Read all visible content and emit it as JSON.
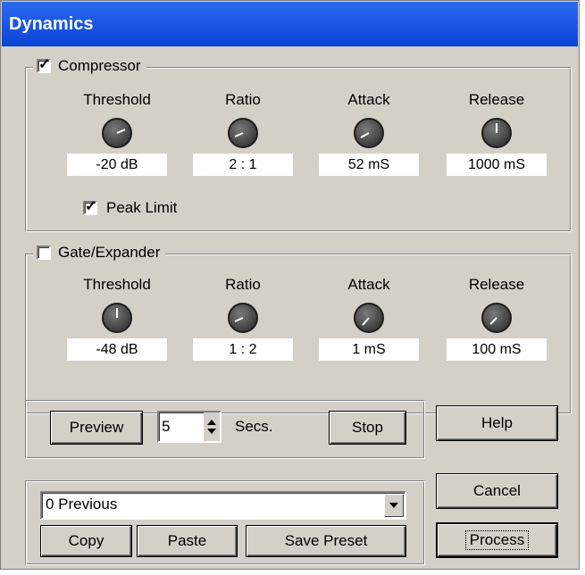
{
  "window": {
    "title": "Dynamics"
  },
  "compressor": {
    "label": "Compressor",
    "enabled": true,
    "knobs": [
      {
        "label": "Threshold",
        "value": "-20 dB"
      },
      {
        "label": "Ratio",
        "value": "2 : 1"
      },
      {
        "label": "Attack",
        "value": "52 mS"
      },
      {
        "label": "Release",
        "value": "1000 mS"
      }
    ],
    "peak_limit": {
      "label": "Peak Limit",
      "checked": true
    }
  },
  "gate": {
    "label": "Gate/Expander",
    "enabled": false,
    "knobs": [
      {
        "label": "Threshold",
        "value": "-48 dB"
      },
      {
        "label": "Ratio",
        "value": "1 : 2"
      },
      {
        "label": "Attack",
        "value": "1 mS"
      },
      {
        "label": "Release",
        "value": "100 mS"
      }
    ]
  },
  "preview": {
    "preview_label": "Preview",
    "seconds_value": "5",
    "seconds_label": "Secs.",
    "stop_label": "Stop"
  },
  "preset": {
    "selected": "0 Previous",
    "copy_label": "Copy",
    "paste_label": "Paste",
    "save_label": "Save Preset"
  },
  "actions": {
    "help_label": "Help",
    "cancel_label": "Cancel",
    "process_label": "Process"
  },
  "icons": {
    "check": "checkmark-icon",
    "spin_up": "triangle-up-icon",
    "spin_down": "triangle-down-icon",
    "dropdown": "triangle-down-icon"
  }
}
